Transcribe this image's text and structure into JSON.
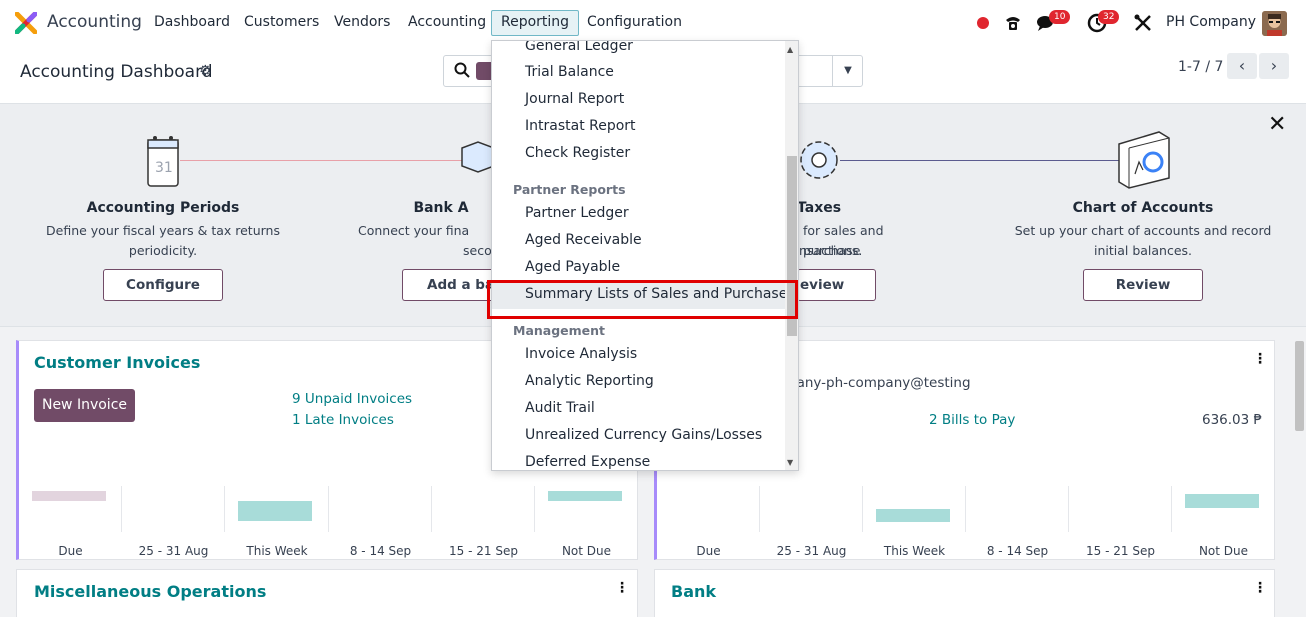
{
  "navbar": {
    "app_name": "Accounting",
    "menu": [
      "Dashboard",
      "Customers",
      "Vendors",
      "Accounting",
      "Reporting",
      "Configuration"
    ],
    "active_menu": "Reporting",
    "messages_count": "10",
    "activities_count": "32",
    "company": "PH Company"
  },
  "control_panel": {
    "title": "Accounting Dashboard",
    "pager": "1-7 / 7"
  },
  "onboarding": {
    "steps": [
      {
        "title": "Accounting Periods",
        "desc1": "Define your fiscal years & tax returns",
        "desc2": "periodicity.",
        "button": "Configure"
      },
      {
        "title": "Bank A",
        "desc1": "Connect your fina",
        "desc2": "seco",
        "button": "Add a ba"
      },
      {
        "title": "Taxes",
        "desc1": "for sales and purchase",
        "desc2": "nsactions.",
        "button": "eview"
      },
      {
        "title": "Chart of Accounts",
        "desc1": "Set up your chart of accounts and record",
        "desc2": "initial balances.",
        "button": "Review"
      }
    ]
  },
  "cards": {
    "customer_invoices": {
      "title": "Customer Invoices",
      "button": "New Invoice",
      "unpaid": "9 Unpaid Invoices",
      "late": "1 Late Invoices"
    },
    "vendor_bills": {
      "email": "pany-ph-company@testing",
      "bills": "2 Bills to Pay",
      "amount": "636.03 ₱"
    },
    "misc": {
      "title": "Miscellaneous Operations"
    },
    "bank": {
      "title": "Bank"
    },
    "graph_labels": [
      "Due",
      "25 - 31 Aug",
      "This Week",
      "8 - 14 Sep",
      "15 - 21 Sep",
      "Not Due"
    ]
  },
  "reporting_dropdown": {
    "items_top": [
      "General Ledger",
      "Trial Balance",
      "Journal Report",
      "Intrastat Report",
      "Check Register"
    ],
    "partner_header": "Partner Reports",
    "partner_items": [
      "Partner Ledger",
      "Aged Receivable",
      "Aged Payable",
      "Summary Lists of Sales and Purchases"
    ],
    "management_header": "Management",
    "management_items": [
      "Invoice Analysis",
      "Analytic Reporting",
      "Audit Trail",
      "Unrealized Currency Gains/Losses",
      "Deferred Expense"
    ]
  },
  "colors": {
    "brand": "#714b67",
    "teal": "#017e84",
    "highlight": "#e00000"
  }
}
